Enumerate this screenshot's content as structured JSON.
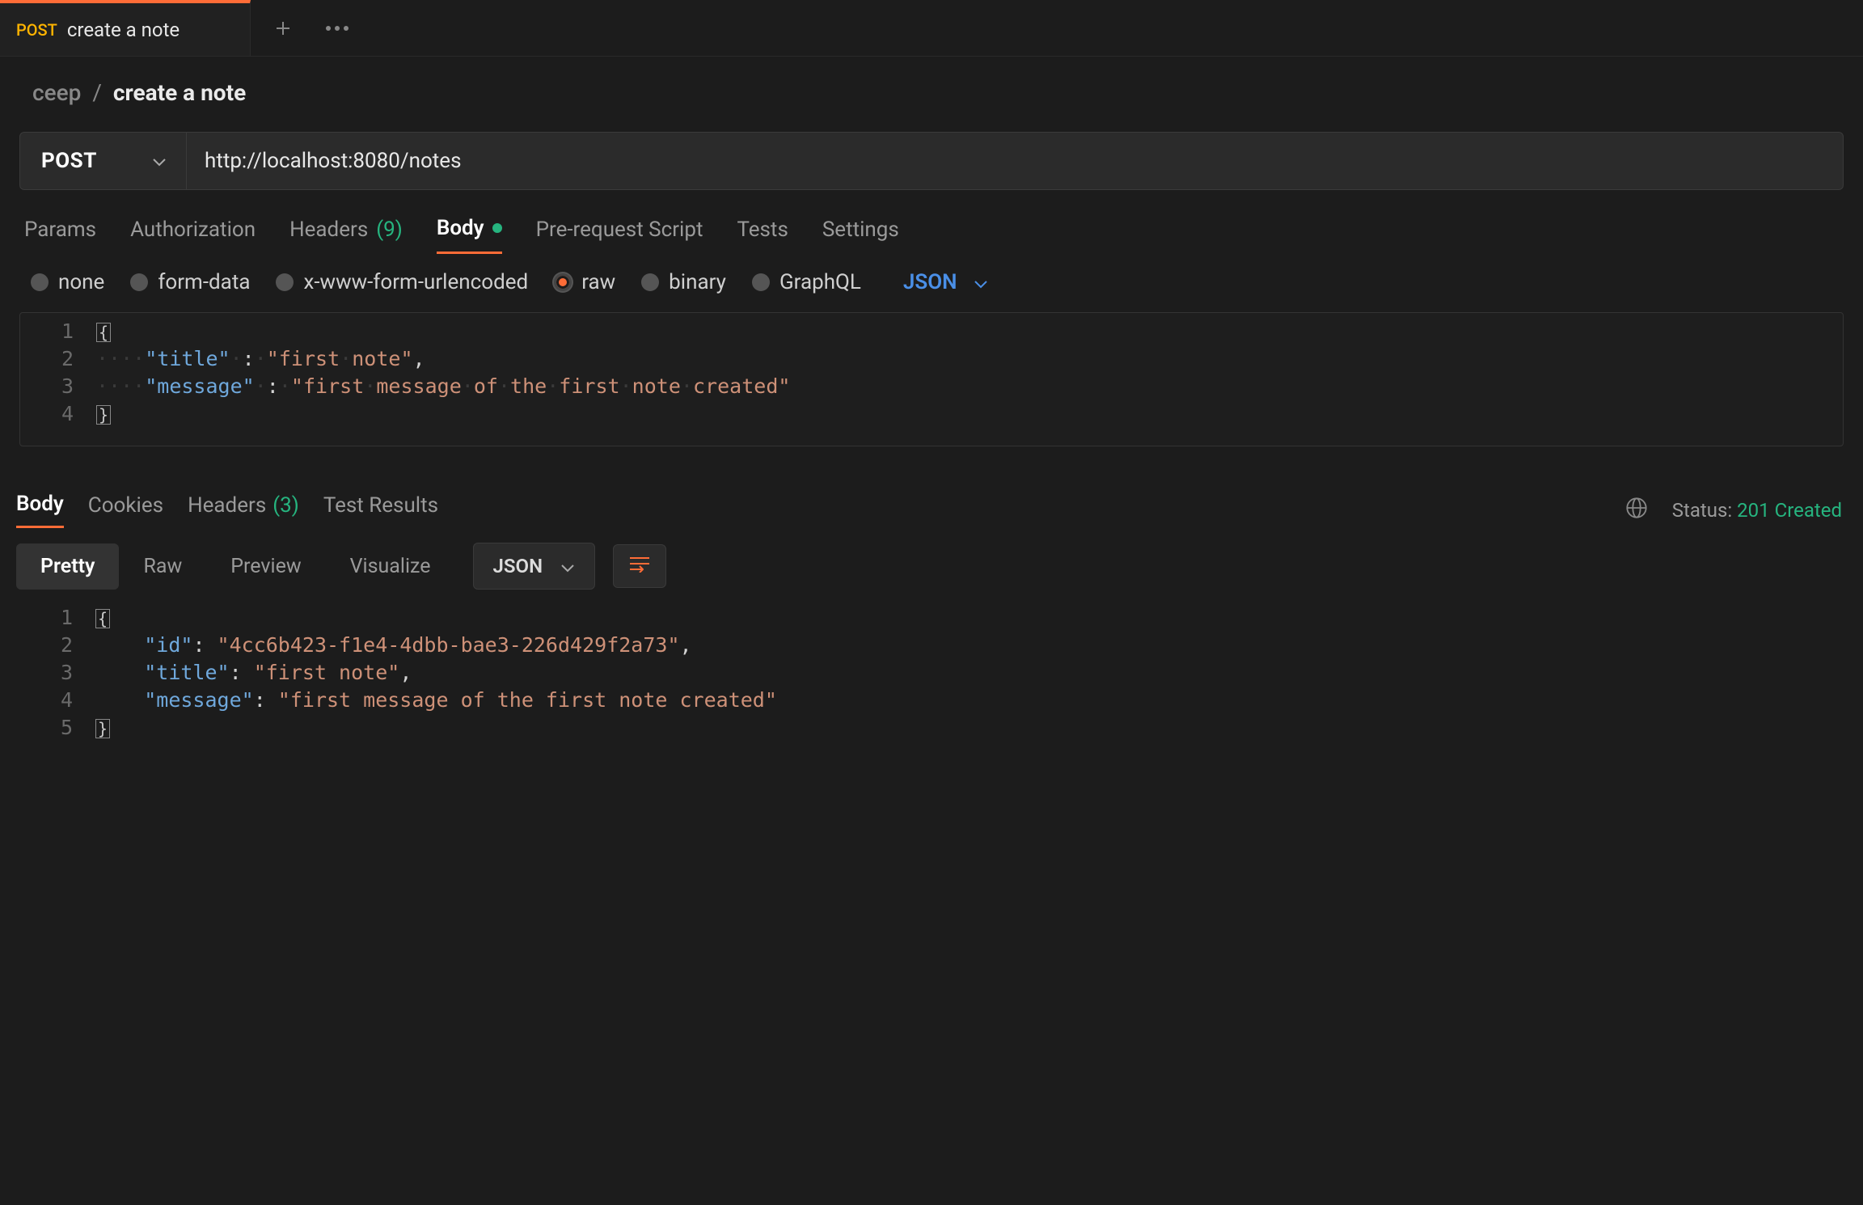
{
  "tabs": {
    "method": "POST",
    "title": "create a note"
  },
  "breadcrumb": {
    "parent": "ceep",
    "separator": "/",
    "current": "create a note"
  },
  "request": {
    "method": "POST",
    "url": "http://localhost:8080/notes"
  },
  "request_tabs": {
    "items": [
      {
        "label": "Params",
        "active": false
      },
      {
        "label": "Authorization",
        "active": false
      },
      {
        "label": "Headers",
        "count": "(9)",
        "active": false
      },
      {
        "label": "Body",
        "dot": true,
        "active": true
      },
      {
        "label": "Pre-request Script",
        "active": false
      },
      {
        "label": "Tests",
        "active": false
      },
      {
        "label": "Settings",
        "active": false
      }
    ]
  },
  "body_types": {
    "items": [
      {
        "label": "none",
        "selected": false
      },
      {
        "label": "form-data",
        "selected": false
      },
      {
        "label": "x-www-form-urlencoded",
        "selected": false
      },
      {
        "label": "raw",
        "selected": true
      },
      {
        "label": "binary",
        "selected": false
      },
      {
        "label": "GraphQL",
        "selected": false
      }
    ],
    "format": "JSON"
  },
  "request_body_editor": {
    "lines": [
      {
        "n": "1",
        "type": "brace",
        "text": "{"
      },
      {
        "n": "2",
        "type": "kv",
        "indent": "····",
        "key": "\"title\"",
        "sep": "·:·",
        "val": "\"first·note\"",
        "comma": ","
      },
      {
        "n": "3",
        "type": "kv",
        "indent": "····",
        "key": "\"message\"",
        "sep": "·:·",
        "val": "\"first·message·of·the·first·note·created\"",
        "comma": ""
      },
      {
        "n": "4",
        "type": "brace",
        "text": "}"
      }
    ]
  },
  "response_tabs": {
    "items": [
      {
        "label": "Body",
        "active": true
      },
      {
        "label": "Cookies",
        "active": false
      },
      {
        "label": "Headers",
        "count": "(3)",
        "active": false
      },
      {
        "label": "Test Results",
        "active": false
      }
    ]
  },
  "response_status": {
    "label": "Status:",
    "value": "201 Created"
  },
  "response_modes": {
    "items": [
      {
        "label": "Pretty",
        "active": true
      },
      {
        "label": "Raw",
        "active": false
      },
      {
        "label": "Preview",
        "active": false
      },
      {
        "label": "Visualize",
        "active": false
      }
    ],
    "format": "JSON"
  },
  "response_body": {
    "lines": [
      {
        "n": "1",
        "type": "brace",
        "text": "{"
      },
      {
        "n": "2",
        "type": "kv",
        "indent": "    ",
        "key": "\"id\"",
        "sep": ": ",
        "val": "\"4cc6b423-f1e4-4dbb-bae3-226d429f2a73\"",
        "comma": ","
      },
      {
        "n": "3",
        "type": "kv",
        "indent": "    ",
        "key": "\"title\"",
        "sep": ": ",
        "val": "\"first note\"",
        "comma": ","
      },
      {
        "n": "4",
        "type": "kv",
        "indent": "    ",
        "key": "\"message\"",
        "sep": ": ",
        "val": "\"first message of the first note created\"",
        "comma": ""
      },
      {
        "n": "5",
        "type": "brace",
        "text": "}"
      }
    ]
  }
}
